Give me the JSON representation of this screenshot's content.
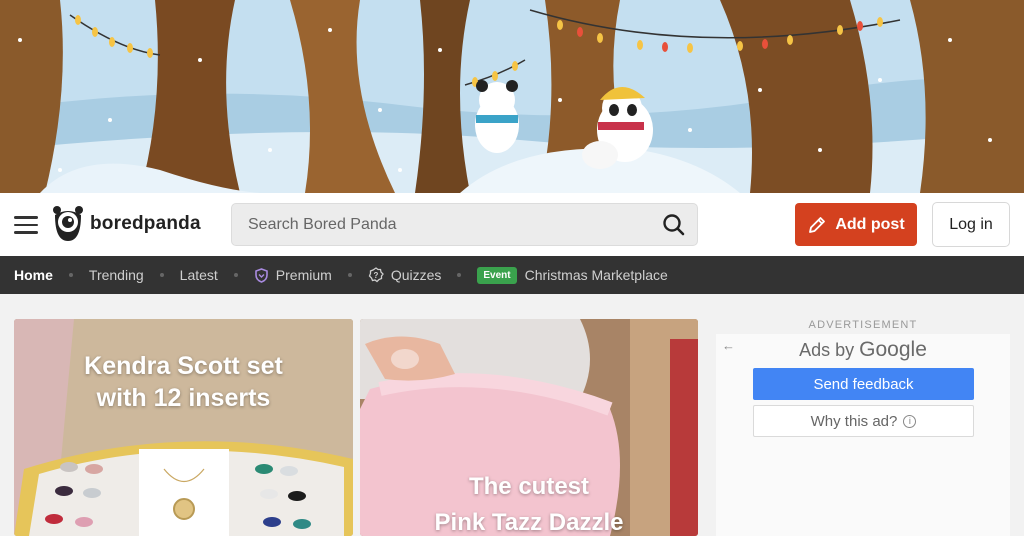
{
  "header": {
    "logo_text": "boredpanda",
    "search_placeholder": "Search Bored Panda",
    "add_post_label": "Add post",
    "login_label": "Log in"
  },
  "nav": {
    "items": [
      {
        "label": "Home",
        "active": true
      },
      {
        "label": "Trending"
      },
      {
        "label": "Latest"
      },
      {
        "label": "Premium",
        "icon": "shield-icon"
      },
      {
        "label": "Quizzes",
        "icon": "question-badge-icon"
      },
      {
        "label": "Christmas Marketplace",
        "badge": "Event"
      }
    ]
  },
  "cards": [
    {
      "caption_line1": "Kendra Scott set",
      "caption_line2": "with 12 inserts"
    },
    {
      "caption_line1": "The cutest",
      "caption_line2": "Pink Tazz Dazzle"
    }
  ],
  "ad": {
    "label": "ADVERTISEMENT",
    "ads_by": "Ads by",
    "ads_brand": "Google",
    "feedback_label": "Send feedback",
    "why_label": "Why this ad?",
    "info_glyph": "i"
  },
  "colors": {
    "accent": "#d4411f",
    "nav_bg": "#333333",
    "event_badge": "#3aa24d",
    "google_blue": "#4285f4"
  }
}
